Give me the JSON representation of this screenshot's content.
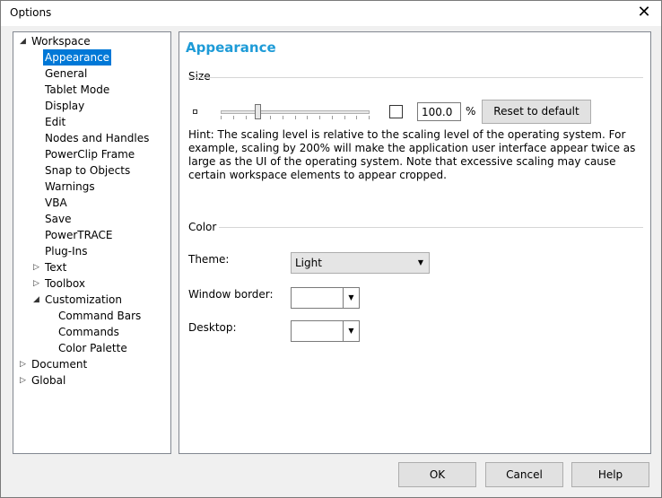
{
  "window": {
    "title": "Options",
    "close_glyph": "✕"
  },
  "tree": [
    {
      "label": "Workspace",
      "level": 0,
      "expander": "expanded"
    },
    {
      "label": "Appearance",
      "level": 1,
      "selected": true
    },
    {
      "label": "General",
      "level": 1
    },
    {
      "label": "Tablet Mode",
      "level": 1
    },
    {
      "label": "Display",
      "level": 1
    },
    {
      "label": "Edit",
      "level": 1
    },
    {
      "label": "Nodes and Handles",
      "level": 1
    },
    {
      "label": "PowerClip Frame",
      "level": 1
    },
    {
      "label": "Snap to Objects",
      "level": 1
    },
    {
      "label": "Warnings",
      "level": 1
    },
    {
      "label": "VBA",
      "level": 1
    },
    {
      "label": "Save",
      "level": 1
    },
    {
      "label": "PowerTRACE",
      "level": 1
    },
    {
      "label": "Plug-Ins",
      "level": 1
    },
    {
      "label": "Text",
      "level": 1,
      "expander": "collapsed"
    },
    {
      "label": "Toolbox",
      "level": 1,
      "expander": "collapsed"
    },
    {
      "label": "Customization",
      "level": 1,
      "expander": "expanded"
    },
    {
      "label": "Command Bars",
      "level": 2
    },
    {
      "label": "Commands",
      "level": 2
    },
    {
      "label": "Color Palette",
      "level": 2
    },
    {
      "label": "Document",
      "level": 0,
      "expander": "collapsed"
    },
    {
      "label": "Global",
      "level": 0,
      "expander": "collapsed"
    }
  ],
  "panel": {
    "title": "Appearance",
    "size_section": "Size",
    "scale_value": "100.0",
    "percent_sign": "%",
    "scale_checked": false,
    "reset_label": "Reset to default",
    "hint": "Hint: The scaling level is relative to the scaling level of the operating system. For example, scaling by 200% will make the application user interface appear twice as large as the UI of the operating system. Note that excessive scaling may cause certain workspace elements to appear cropped.",
    "color_section": "Color",
    "theme_label": "Theme:",
    "theme_value": "Light",
    "window_border_label": "Window border:",
    "window_border_value": "",
    "desktop_label": "Desktop:",
    "desktop_value": ""
  },
  "buttons": {
    "ok": "OK",
    "cancel": "Cancel",
    "help": "Help"
  },
  "colors": {
    "accent": "#1e9bd7",
    "selection": "#0078d7"
  }
}
